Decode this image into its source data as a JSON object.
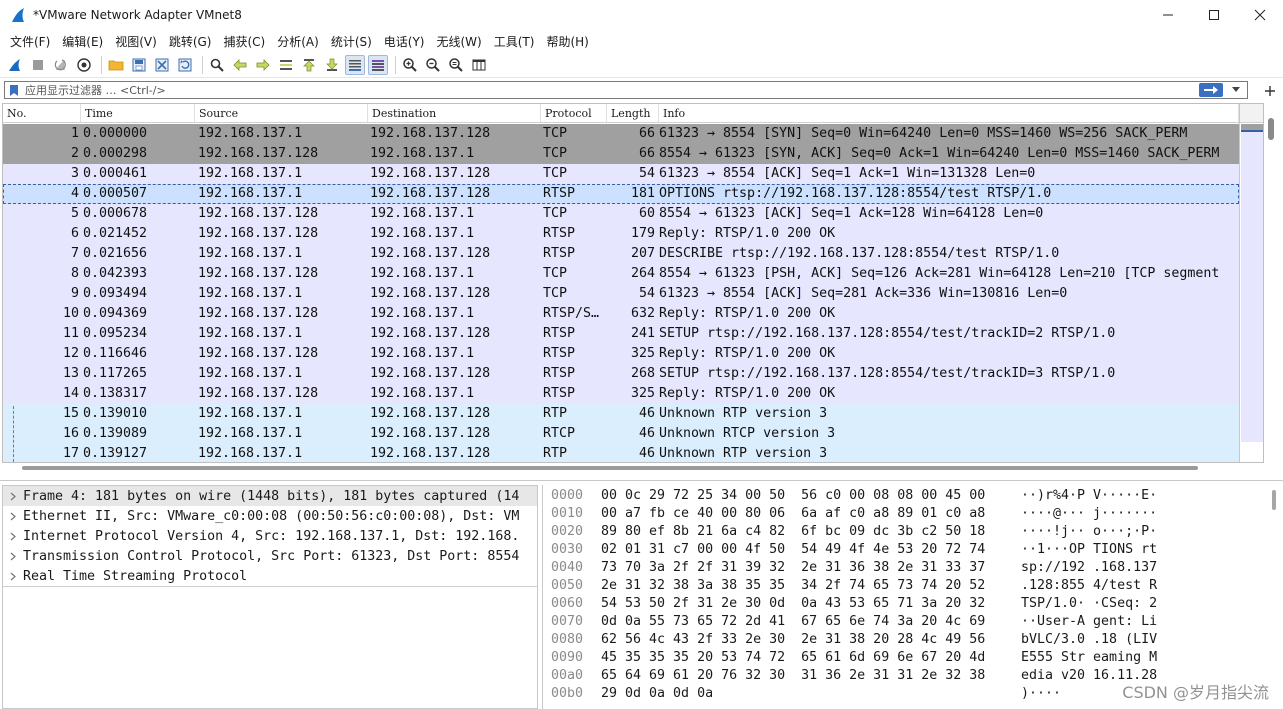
{
  "window": {
    "title": "*VMware Network Adapter VMnet8",
    "icon": "wireshark-fin-icon"
  },
  "menu": [
    "文件(F)",
    "编辑(E)",
    "视图(V)",
    "跳转(G)",
    "捕获(C)",
    "分析(A)",
    "统计(S)",
    "电话(Y)",
    "无线(W)",
    "工具(T)",
    "帮助(H)"
  ],
  "toolbar": {
    "icons": [
      "shark-fin-icon",
      "stop-icon",
      "restart-icon",
      "capture-options-icon",
      "open-folder-icon",
      "save-icon",
      "close-file-icon",
      "reload-icon",
      "find-icon",
      "back-arrow-icon",
      "forward-arrow-icon",
      "goto-packet-icon",
      "first-packet-icon",
      "last-packet-icon",
      "autoscroll-icon",
      "colorize-icon",
      "zoom-in-icon",
      "zoom-out-icon",
      "zoom-reset-icon",
      "resize-columns-icon"
    ]
  },
  "filter": {
    "placeholder": "应用显示过滤器 … <Ctrl-/>"
  },
  "columns": [
    "No.",
    "Time",
    "Source",
    "Destination",
    "Protocol",
    "Length",
    "Info"
  ],
  "colors": {
    "tcp_flag": "#a0a0a0",
    "tcp": "#e7e6ff",
    "selected": "#cce0ff",
    "rtp": "#daeefe"
  },
  "packets": [
    {
      "no": "1",
      "time": "0.000000",
      "src": "192.168.137.1",
      "dst": "192.168.137.128",
      "proto": "TCP",
      "len": "66",
      "info": "61323 → 8554 [SYN] Seq=0 Win=64240 Len=0 MSS=1460 WS=256 SACK_PERM",
      "color": "#a0a0a0"
    },
    {
      "no": "2",
      "time": "0.000298",
      "src": "192.168.137.128",
      "dst": "192.168.137.1",
      "proto": "TCP",
      "len": "66",
      "info": "8554 → 61323 [SYN, ACK] Seq=0 Ack=1 Win=64240 Len=0 MSS=1460 SACK_PERM",
      "color": "#a0a0a0"
    },
    {
      "no": "3",
      "time": "0.000461",
      "src": "192.168.137.1",
      "dst": "192.168.137.128",
      "proto": "TCP",
      "len": "54",
      "info": "61323 → 8554 [ACK] Seq=1 Ack=1 Win=131328 Len=0",
      "color": "#e7e6ff"
    },
    {
      "no": "4",
      "time": "0.000507",
      "src": "192.168.137.1",
      "dst": "192.168.137.128",
      "proto": "RTSP",
      "len": "181",
      "info": "OPTIONS rtsp://192.168.137.128:8554/test RTSP/1.0",
      "color": "#cce0ff"
    },
    {
      "no": "5",
      "time": "0.000678",
      "src": "192.168.137.128",
      "dst": "192.168.137.1",
      "proto": "TCP",
      "len": "60",
      "info": "8554 → 61323 [ACK] Seq=1 Ack=128 Win=64128 Len=0",
      "color": "#e7e6ff"
    },
    {
      "no": "6",
      "time": "0.021452",
      "src": "192.168.137.128",
      "dst": "192.168.137.1",
      "proto": "RTSP",
      "len": "179",
      "info": "Reply: RTSP/1.0 200 OK",
      "color": "#e7e6ff"
    },
    {
      "no": "7",
      "time": "0.021656",
      "src": "192.168.137.1",
      "dst": "192.168.137.128",
      "proto": "RTSP",
      "len": "207",
      "info": "DESCRIBE rtsp://192.168.137.128:8554/test RTSP/1.0",
      "color": "#e7e6ff"
    },
    {
      "no": "8",
      "time": "0.042393",
      "src": "192.168.137.128",
      "dst": "192.168.137.1",
      "proto": "TCP",
      "len": "264",
      "info": "8554 → 61323 [PSH, ACK] Seq=126 Ack=281 Win=64128 Len=210 [TCP segment",
      "color": "#e7e6ff"
    },
    {
      "no": "9",
      "time": "0.093494",
      "src": "192.168.137.1",
      "dst": "192.168.137.128",
      "proto": "TCP",
      "len": "54",
      "info": "61323 → 8554 [ACK] Seq=281 Ack=336 Win=130816 Len=0",
      "color": "#e7e6ff"
    },
    {
      "no": "10",
      "time": "0.094369",
      "src": "192.168.137.128",
      "dst": "192.168.137.1",
      "proto": "RTSP/S…",
      "len": "632",
      "info": "Reply: RTSP/1.0 200 OK",
      "color": "#e7e6ff"
    },
    {
      "no": "11",
      "time": "0.095234",
      "src": "192.168.137.1",
      "dst": "192.168.137.128",
      "proto": "RTSP",
      "len": "241",
      "info": "SETUP rtsp://192.168.137.128:8554/test/trackID=2 RTSP/1.0",
      "color": "#e7e6ff"
    },
    {
      "no": "12",
      "time": "0.116646",
      "src": "192.168.137.128",
      "dst": "192.168.137.1",
      "proto": "RTSP",
      "len": "325",
      "info": "Reply: RTSP/1.0 200 OK",
      "color": "#e7e6ff"
    },
    {
      "no": "13",
      "time": "0.117265",
      "src": "192.168.137.1",
      "dst": "192.168.137.128",
      "proto": "RTSP",
      "len": "268",
      "info": "SETUP rtsp://192.168.137.128:8554/test/trackID=3 RTSP/1.0",
      "color": "#e7e6ff"
    },
    {
      "no": "14",
      "time": "0.138317",
      "src": "192.168.137.128",
      "dst": "192.168.137.1",
      "proto": "RTSP",
      "len": "325",
      "info": "Reply: RTSP/1.0 200 OK",
      "color": "#e7e6ff"
    },
    {
      "no": "15",
      "time": "0.139010",
      "src": "192.168.137.1",
      "dst": "192.168.137.128",
      "proto": "RTP",
      "len": "46",
      "info": "Unknown RTP version 3",
      "color": "#daeefe"
    },
    {
      "no": "16",
      "time": "0.139089",
      "src": "192.168.137.1",
      "dst": "192.168.137.128",
      "proto": "RTCP",
      "len": "46",
      "info": "Unknown RTCP version 3",
      "color": "#daeefe"
    },
    {
      "no": "17",
      "time": "0.139127",
      "src": "192.168.137.1",
      "dst": "192.168.137.128",
      "proto": "RTP",
      "len": "46",
      "info": "Unknown RTP version 3",
      "color": "#daeefe"
    }
  ],
  "details": [
    "Frame 4: 181 bytes on wire (1448 bits), 181 bytes captured (14",
    "Ethernet II, Src: VMware_c0:00:08 (00:50:56:c0:00:08), Dst: VM",
    "Internet Protocol Version 4, Src: 192.168.137.1, Dst: 192.168.",
    "Transmission Control Protocol, Src Port: 61323, Dst Port: 8554",
    "Real Time Streaming Protocol"
  ],
  "bytes": [
    {
      "off": "0000",
      "hex": "00 0c 29 72 25 34 00 50  56 c0 00 08 08 00 45 00",
      "ascii": "··)r%4·P V·····E·"
    },
    {
      "off": "0010",
      "hex": "00 a7 fb ce 40 00 80 06  6a af c0 a8 89 01 c0 a8",
      "ascii": "····@··· j·······"
    },
    {
      "off": "0020",
      "hex": "89 80 ef 8b 21 6a c4 82  6f bc 09 dc 3b c2 50 18",
      "ascii": "····!j·· o···;·P·"
    },
    {
      "off": "0030",
      "hex": "02 01 31 c7 00 00 4f 50  54 49 4f 4e 53 20 72 74",
      "ascii": "··1···OP TIONS rt"
    },
    {
      "off": "0040",
      "hex": "73 70 3a 2f 2f 31 39 32  2e 31 36 38 2e 31 33 37",
      "ascii": "sp://192 .168.137"
    },
    {
      "off": "0050",
      "hex": "2e 31 32 38 3a 38 35 35  34 2f 74 65 73 74 20 52",
      "ascii": ".128:855 4/test R"
    },
    {
      "off": "0060",
      "hex": "54 53 50 2f 31 2e 30 0d  0a 43 53 65 71 3a 20 32",
      "ascii": "TSP/1.0· ·CSeq: 2"
    },
    {
      "off": "0070",
      "hex": "0d 0a 55 73 65 72 2d 41  67 65 6e 74 3a 20 4c 69",
      "ascii": "··User-A gent: Li"
    },
    {
      "off": "0080",
      "hex": "62 56 4c 43 2f 33 2e 30  2e 31 38 20 28 4c 49 56",
      "ascii": "bVLC/3.0 .18 (LIV"
    },
    {
      "off": "0090",
      "hex": "45 35 35 35 20 53 74 72  65 61 6d 69 6e 67 20 4d",
      "ascii": "E555 Str eaming M"
    },
    {
      "off": "00a0",
      "hex": "65 64 69 61 20 76 32 30  31 36 2e 31 31 2e 32 38",
      "ascii": "edia v20 16.11.28"
    },
    {
      "off": "00b0",
      "hex": "29 0d 0a 0d 0a",
      "ascii": ")····"
    }
  ],
  "watermark": "CSDN @岁月指尖流"
}
